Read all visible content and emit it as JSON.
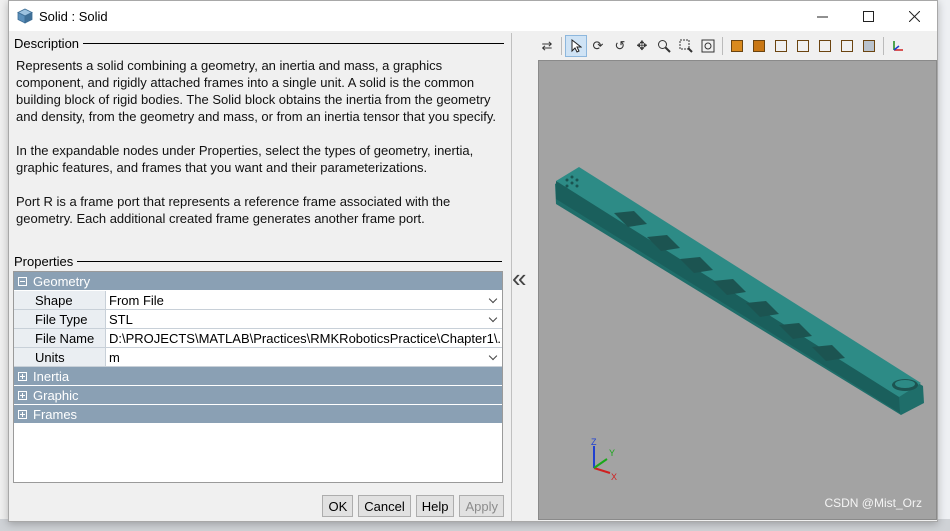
{
  "window": {
    "title": "Solid : Solid"
  },
  "description": {
    "heading": "Description",
    "paragraphs": [
      "Represents a solid combining a geometry, an inertia and mass, a graphics component, and rigidly attached frames into a single unit. A solid is the common building block of rigid bodies. The Solid block obtains the inertia from the geometry and density, from the geometry and mass, or from an inertia tensor that you specify.",
      "In the expandable nodes under Properties, select the types of geometry, inertia, graphic features, and frames that you want and their parameterizations.",
      "Port R is a frame port that represents a reference frame associated with the geometry. Each additional created frame generates another frame port."
    ]
  },
  "properties": {
    "heading": "Properties",
    "geometry": {
      "label": "Geometry",
      "rows": [
        {
          "label": "Shape",
          "value": "From File",
          "dropdown": true
        },
        {
          "label": "File Type",
          "value": "STL",
          "dropdown": true
        },
        {
          "label": "File Name",
          "value": "D:\\PROJECTS\\MATLAB\\Practices\\RMKRoboticsPractice\\Chapter1\\...",
          "dropdown": false
        },
        {
          "label": "Units",
          "value": "m",
          "dropdown": true
        }
      ]
    },
    "collapsed_groups": [
      "Inertia",
      "Graphic",
      "Frames"
    ]
  },
  "buttons": {
    "ok": "OK",
    "cancel": "Cancel",
    "help": "Help",
    "apply": "Apply"
  },
  "axes": {
    "x": "X",
    "y": "Y",
    "z": "Z"
  },
  "watermark": "CSDN @Mist_Orz",
  "colors": {
    "viewport_bg": "#a3a3a3",
    "solid": "#2a7f7b",
    "group_header": "#8aa0b4"
  }
}
